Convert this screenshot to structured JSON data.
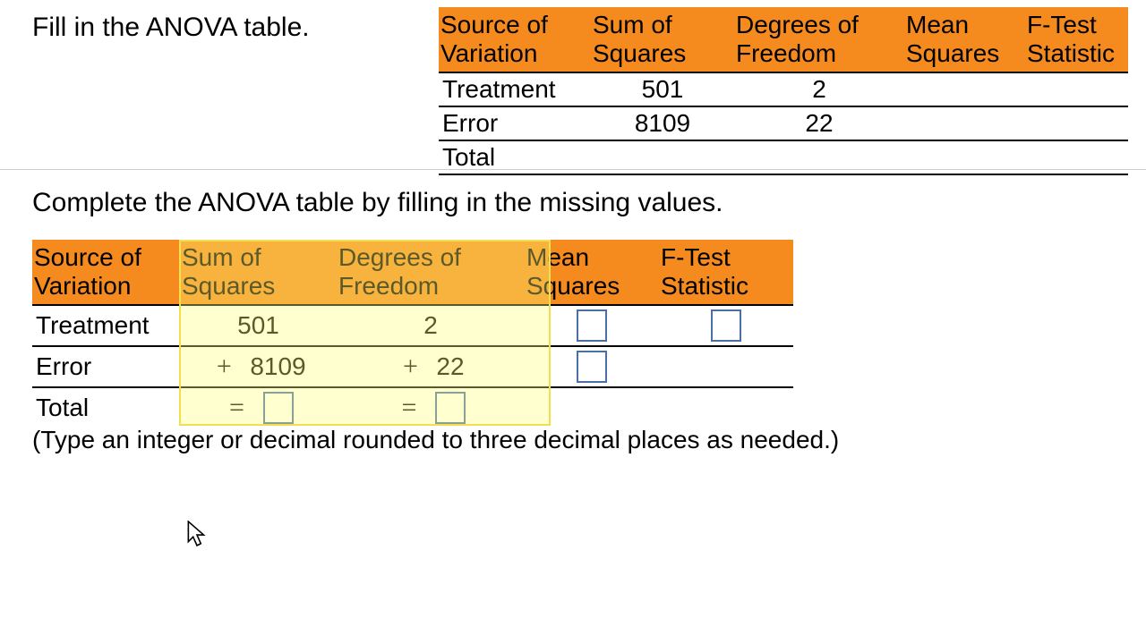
{
  "instruction_top": "Fill in the ANOVA table.",
  "instruction_mid": "Complete the ANOVA table by filling in the missing values.",
  "hint": "(Type an integer or decimal rounded to three decimal places as needed.)",
  "headers": {
    "source": "Source of\nVariation",
    "ss": "Sum of\nSquares",
    "df": "Degrees of\nFreedom",
    "ms": "Mean\nSquares",
    "f": "F-Test\nStatistic"
  },
  "rows": {
    "treatment": {
      "label": "Treatment",
      "ss": "501",
      "df": "2"
    },
    "error": {
      "label": "Error",
      "ss": "8109",
      "df": "22"
    },
    "total": {
      "label": "Total"
    }
  },
  "ops": {
    "plus": "+",
    "equals": "="
  },
  "chart_data": {
    "type": "table",
    "title": "ANOVA table",
    "columns": [
      "Source of Variation",
      "Sum of Squares",
      "Degrees of Freedom",
      "Mean Squares",
      "F-Test Statistic"
    ],
    "rows": [
      {
        "Source of Variation": "Treatment",
        "Sum of Squares": 501,
        "Degrees of Freedom": 2,
        "Mean Squares": null,
        "F-Test Statistic": null
      },
      {
        "Source of Variation": "Error",
        "Sum of Squares": 8109,
        "Degrees of Freedom": 22,
        "Mean Squares": null,
        "F-Test Statistic": null
      },
      {
        "Source of Variation": "Total",
        "Sum of Squares": null,
        "Degrees of Freedom": null,
        "Mean Squares": null,
        "F-Test Statistic": null
      }
    ]
  }
}
